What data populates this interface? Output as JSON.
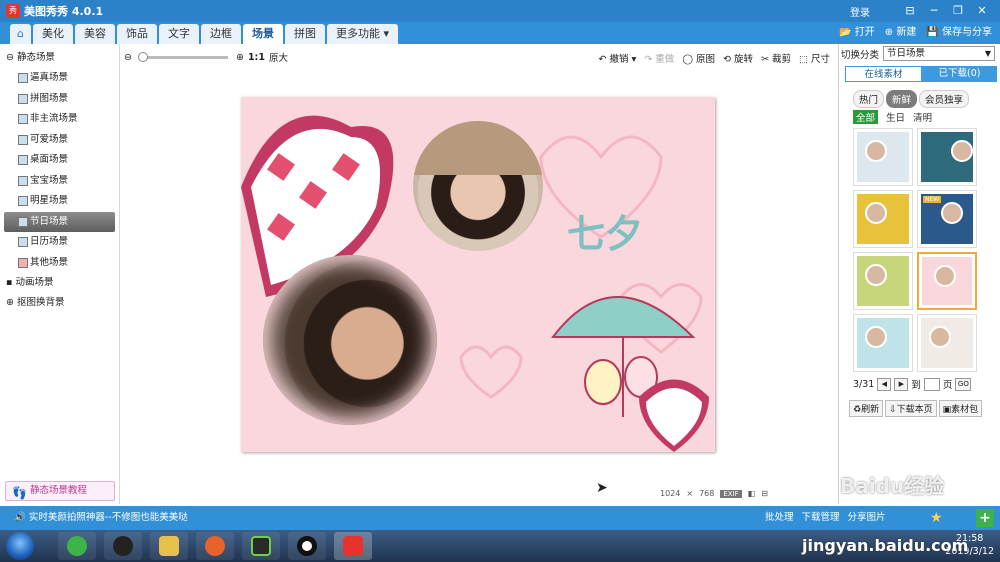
{
  "app": {
    "title": "美图秀秀 4.0.1",
    "logo_text": "秀",
    "login": "登录",
    "win_min": "─",
    "win_restore": "❐",
    "win_close": "✕",
    "win_skin": "⊟"
  },
  "tabs": [
    "美化",
    "美容",
    "饰品",
    "文字",
    "边框",
    "场景",
    "拼图",
    "更多功能 ▾"
  ],
  "home_icon": "⌂",
  "top_actions": {
    "open": "打开",
    "new": "新建",
    "save": "保存与分享"
  },
  "left_tree": {
    "group1": "静态场景",
    "items": [
      "逼真场景",
      "拼图场景",
      "非主流场景",
      "可爱场景",
      "桌面场景",
      "宝宝场景",
      "明星场景",
      "节日场景",
      "日历场景",
      "其他场景"
    ],
    "active_index": 7,
    "group2": "动画场景",
    "group3": "抠图换背景",
    "tutorial": "静态场景教程"
  },
  "toolbar": {
    "zoom_label": "1:1",
    "zoom_text": "原大",
    "undo": "撤销",
    "redo": "重做",
    "original": "原图",
    "rotate": "旋转",
    "crop": "裁剪",
    "resize": "尺寸",
    "zoom_out": "⊖",
    "zoom_in": "⊕"
  },
  "canvas": {
    "text": "七夕",
    "width": "1024",
    "x": "×",
    "height": "768",
    "exif": "EXIF"
  },
  "right_panel": {
    "category_label": "切换分类",
    "category_value": "节日场景",
    "tab_online": "在线素材",
    "tab_downloaded": "已下载(0)",
    "sub_tabs": [
      "热门",
      "新鲜",
      "会员独享"
    ],
    "sub_active": 1,
    "filters": [
      "全部",
      "生日",
      "清明"
    ],
    "page": "3/31",
    "page_to": "到",
    "page_unit": "页",
    "go": "GO",
    "btn_refresh": "刷新",
    "btn_download": "下载本页",
    "btn_pack": "素材包",
    "badge_new": "NEW"
  },
  "status": {
    "message": "实时美颜拍照神器--不修图也能美美哒",
    "batch": "批处理",
    "download": "下载管理",
    "share": "分享图片"
  },
  "taskbar": {
    "time": "21:58",
    "date": "2019/3/12"
  },
  "watermark": "Baidu经验",
  "watermark2": "jingyan.baidu.com",
  "colors": {
    "title_bar": "#2b82c9",
    "tab_bar": "#3290d8",
    "canvas_bg": "#f9d7dc",
    "accent_green": "#2a9a3b"
  }
}
